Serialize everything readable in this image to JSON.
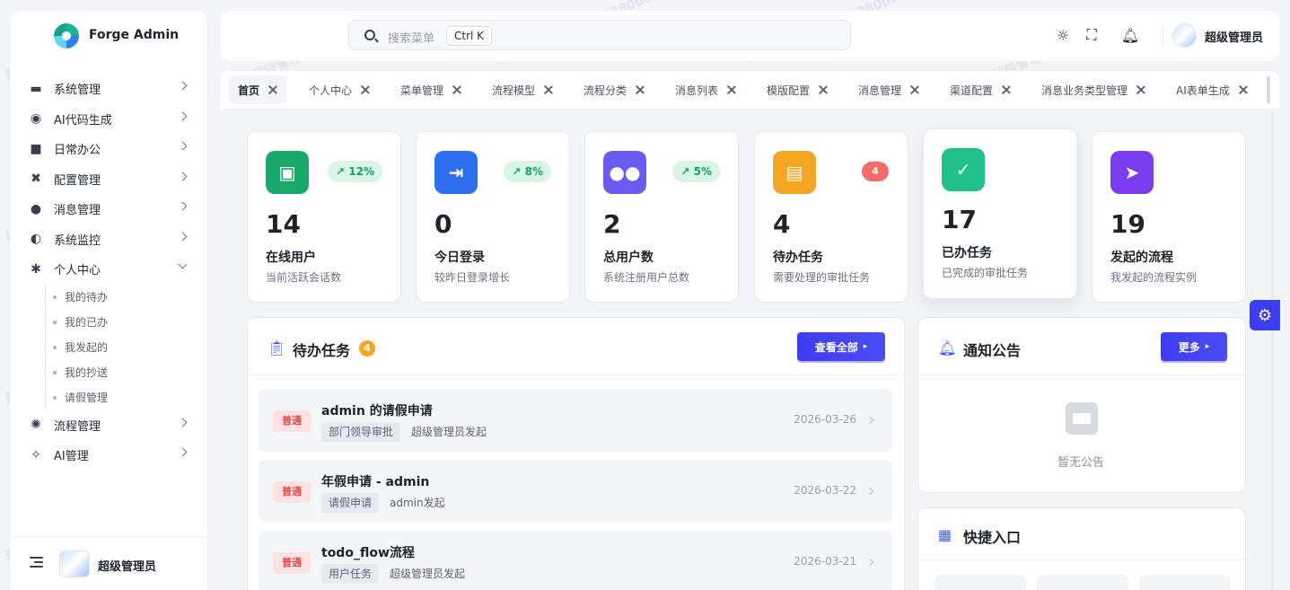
{
  "brand": {
    "name": "Forge Admin"
  },
  "sidebar": {
    "items": [
      {
        "label": "系统管理",
        "icon": "folder-icon"
      },
      {
        "label": "AI代码生成",
        "icon": "ai-code-icon"
      },
      {
        "label": "日常办公",
        "icon": "briefcase-icon"
      },
      {
        "label": "配置管理",
        "icon": "tools-icon"
      },
      {
        "label": "消息管理",
        "icon": "message-icon"
      },
      {
        "label": "系统监控",
        "icon": "monitor-icon"
      },
      {
        "label": "个人中心",
        "icon": "person-icon",
        "expanded": true
      }
    ],
    "sub_items": [
      "我的待办",
      "我的已办",
      "我发起的",
      "我的抄送",
      "请假管理"
    ],
    "items_after": [
      {
        "label": "流程管理",
        "icon": "gear-icon"
      },
      {
        "label": "AI管理",
        "icon": "magic-wand-icon"
      }
    ],
    "footer_user": "超级管理员"
  },
  "header": {
    "search_placeholder": "搜索菜单",
    "search_shortcut": "Ctrl K",
    "user_name": "超级管理员"
  },
  "tabs": [
    "首页",
    "个人中心",
    "菜单管理",
    "流程模型",
    "流程分类",
    "消息列表",
    "模版配置",
    "消息管理",
    "渠道配置",
    "消息业务类型管理",
    "AI表单生成"
  ],
  "stats": [
    {
      "value": "14",
      "label": "在线用户",
      "desc": "当前活跃会话数",
      "trend": "12%",
      "color": "#1aa86a",
      "icon": "id-card-icon"
    },
    {
      "value": "0",
      "label": "今日登录",
      "desc": "较昨日登录增长",
      "trend": "8%",
      "color": "#2d6ff0",
      "icon": "login-icon"
    },
    {
      "value": "2",
      "label": "总用户数",
      "desc": "系统注册用户总数",
      "trend": "5%",
      "color": "#6a5cf0",
      "icon": "users-icon"
    },
    {
      "value": "4",
      "label": "待办任务",
      "desc": "需要处理的审批任务",
      "badge": "4",
      "color": "#f5a623",
      "icon": "clipboard-clock-icon"
    },
    {
      "value": "17",
      "label": "已办任务",
      "desc": "已完成的审批任务",
      "color": "#1fc08a",
      "icon": "check-circle-icon"
    },
    {
      "value": "19",
      "label": "发起的流程",
      "desc": "我发起的流程实例",
      "color": "#7a3ef0",
      "icon": "send-icon"
    }
  ],
  "todo_panel": {
    "title": "待办任务",
    "badge": "4",
    "view_all": "查看全部",
    "tasks": [
      {
        "tag": "普通",
        "title": "admin 的请假申请",
        "chip": "部门领导审批",
        "meta": "超级管理员发起",
        "date": "2026-03-26"
      },
      {
        "tag": "普通",
        "title": "年假申请 - admin",
        "chip": "请假申请",
        "meta": "admin发起",
        "date": "2026-03-22"
      },
      {
        "tag": "普通",
        "title": "todo_flow流程",
        "chip": "用户任务",
        "meta": "超级管理员发起",
        "date": "2026-03-21"
      }
    ]
  },
  "notice_panel": {
    "title": "通知公告",
    "more": "更多",
    "empty": "暂无公告"
  },
  "quick_panel": {
    "title": "快捷入口"
  },
  "watermark": "超级管理员 13800138000",
  "colors": {
    "primary": "#3d3df0",
    "success": "#10a36b",
    "danger": "#e5484d"
  }
}
